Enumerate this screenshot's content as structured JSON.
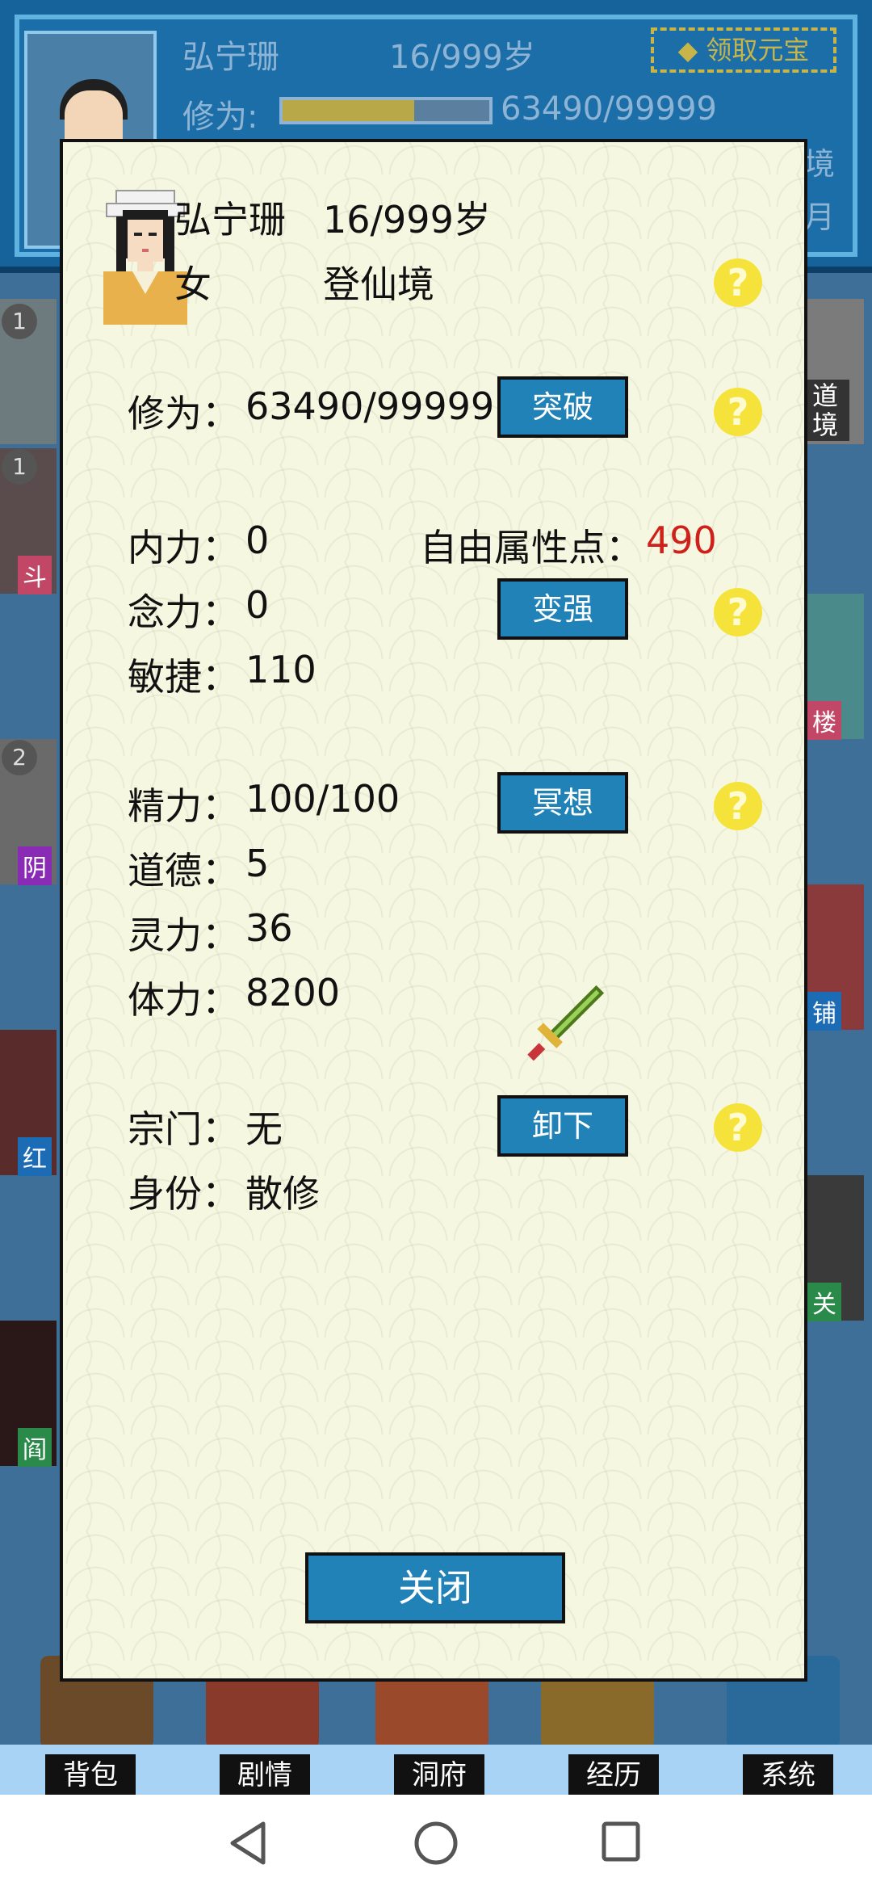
{
  "background": {
    "name": "弘宁珊",
    "age": "16/999岁",
    "xiuwei_label": "修为:",
    "xiuwei_progress": 0.635,
    "xiuwei_value": "63490/99999",
    "claim_button": "领取元宝",
    "side_right_text": [
      "境",
      "月"
    ],
    "side_badges": [
      "1",
      "1",
      "2"
    ],
    "side_tags_left": [
      "斗",
      "阴",
      "红",
      "阎"
    ],
    "side_tags_right": [
      "道境",
      "楼",
      "铺",
      "关"
    ]
  },
  "modal": {
    "name": "弘宁珊",
    "age": "16/999岁",
    "gender": "女",
    "realm": "登仙境",
    "xiuwei_label": "修为：",
    "xiuwei_value": "63490/99999",
    "breakthrough_button": "突破",
    "neili_label": "内力：",
    "neili_value": "0",
    "free_points_label": "自由属性点：",
    "free_points_value": "490",
    "nianli_label": "念力：",
    "nianli_value": "0",
    "strengthen_button": "变强",
    "minjie_label": "敏捷：",
    "minjie_value": "110",
    "jingli_label": "精力：",
    "jingli_value": "100/100",
    "meditate_button": "冥想",
    "daode_label": "道德：",
    "daode_value": "5",
    "lingli_label": "灵力：",
    "lingli_value": "36",
    "tili_label": "体力：",
    "tili_value": "8200",
    "zongmen_label": "宗门：",
    "zongmen_value": "无",
    "unequip_button": "卸下",
    "shenfen_label": "身份：",
    "shenfen_value": "散修",
    "help_icon": "?",
    "close_button": "关闭"
  },
  "bottom_nav": [
    "背包",
    "剧情",
    "洞府",
    "经历",
    "系统"
  ],
  "colors": {
    "accent_button": "#2182b8",
    "highlight_red": "#d0201a",
    "help_yellow": "#f5e33b",
    "modal_bg": "#f6f7e1"
  }
}
